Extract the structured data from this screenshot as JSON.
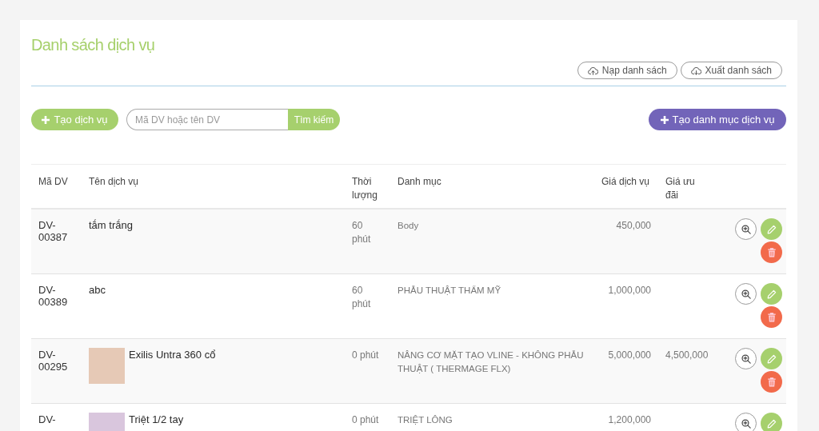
{
  "page": {
    "title": "Danh sách dịch vụ"
  },
  "header_actions": [
    {
      "kind": "import",
      "label": "Nạp danh sách"
    },
    {
      "kind": "export",
      "label": "Xuất danh sách"
    }
  ],
  "toolbar": {
    "create_button": "Tạo dịch vụ",
    "search": {
      "placeholder": "Mã DV hoặc tên DV",
      "button": "Tìm kiếm"
    },
    "category_button": "Tạo danh mục dịch vụ"
  },
  "table": {
    "columns": [
      "Mã DV",
      "Tên dịch vụ",
      "Thời lượng",
      "Danh mục",
      "Giá dịch vụ",
      "Giá ưu đãi"
    ],
    "rows": [
      {
        "code": "DV-00387",
        "name": "tắm trắng",
        "photo": false,
        "duration": "60 phút",
        "category": "Body",
        "price": "450,000",
        "actions": [
          {
            "kind": "view"
          },
          {
            "kind": "edit"
          },
          {
            "kind": "delete"
          }
        ]
      },
      {
        "code": "DV-00389",
        "name": "abc",
        "photo": false,
        "duration": "60 phút",
        "category": "PHẪU THUẬT THẨM MỸ",
        "price": "1,000,000",
        "actions": [
          {
            "kind": "view"
          },
          {
            "kind": "edit"
          },
          {
            "kind": "delete"
          }
        ]
      },
      {
        "code": "DV-00295",
        "name": "Exilis Untra 360 cổ",
        "photo": true,
        "duration": "0 phút",
        "category": "NÂNG CƠ MẶT TẠO VLINE - KHÔNG PHẪU THUẬT ( THERMAGE FLX)",
        "price": "5,000,000",
        "discount_price": "4,500,000",
        "actions": [
          {
            "kind": "view"
          },
          {
            "kind": "edit"
          },
          {
            "kind": "delete"
          }
        ]
      },
      {
        "code": "DV-",
        "name": "Triệt 1/2 tay",
        "photo": true,
        "duration": "0 phút",
        "category": "TRIỆT LÔNG",
        "price": "1,200,000",
        "actions": [
          {
            "kind": "view"
          },
          {
            "kind": "edit"
          }
        ]
      }
    ]
  }
}
